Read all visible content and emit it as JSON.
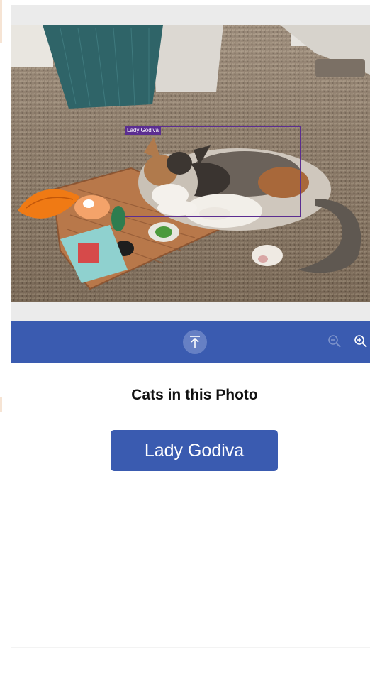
{
  "photo": {
    "detections": [
      {
        "label": "Lady Godiva"
      }
    ]
  },
  "toolbar": {
    "upload_icon": "upload-arrow-icon",
    "zoom_out_icon": "zoom-out-icon",
    "zoom_in_icon": "zoom-in-icon"
  },
  "cats_section": {
    "heading": "Cats in this Photo",
    "cats": [
      "Lady Godiva"
    ]
  },
  "colors": {
    "accent": "#3a5bb0",
    "detection_box": "#5b2d91",
    "upload_button_bg": "#6680c4"
  }
}
